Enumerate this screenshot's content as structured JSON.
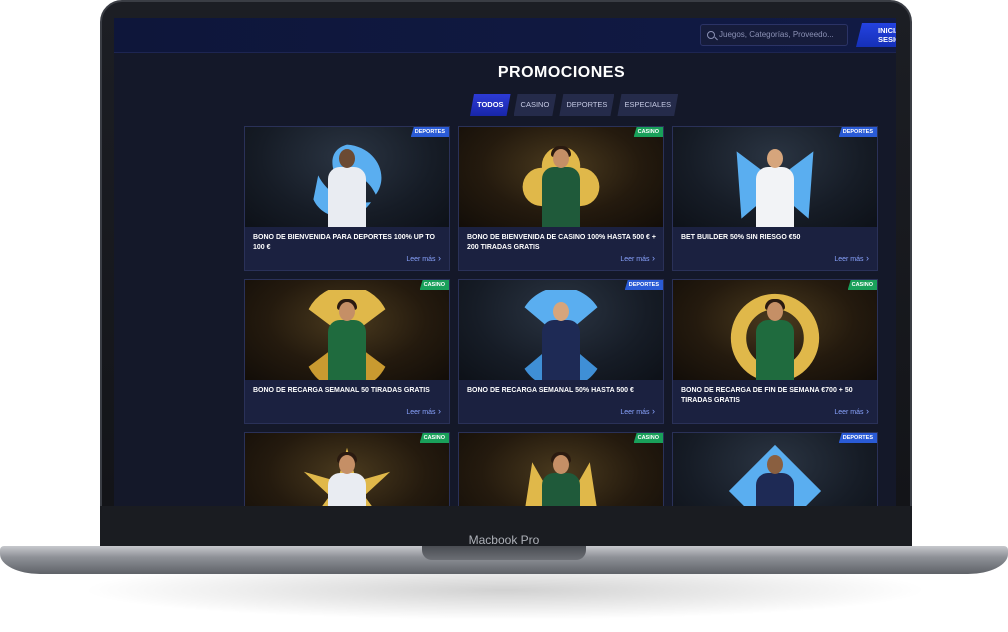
{
  "device": {
    "label": "Macbook Pro"
  },
  "header": {
    "search_placeholder": "Juegos, Categorías, Proveedo...",
    "login_label": "INICIAR SESIÓN"
  },
  "page": {
    "title": "PROMOCIONES"
  },
  "tabs": [
    {
      "label": "TODOS",
      "active": true
    },
    {
      "label": "CASINO",
      "active": false
    },
    {
      "label": "DEPORTES",
      "active": false
    },
    {
      "label": "ESPECIALES",
      "active": false
    }
  ],
  "promotions": [
    {
      "category": "DEPORTES",
      "title": "BONO DE BIENVENIDA PARA DEPORTES 100% UP TO 100 €",
      "link": "Leer más"
    },
    {
      "category": "CASINO",
      "title": "BONO DE BIENVENIDA DE CASINO 100% HASTA 500 € + 200 TIRADAS GRATIS",
      "link": "Leer más"
    },
    {
      "category": "DEPORTES",
      "title": "BET BUILDER 50% SIN RIESGO €50",
      "link": "Leer más"
    },
    {
      "category": "CASINO",
      "title": "BONO DE RECARGA SEMANAL 50 TIRADAS GRATIS",
      "link": "Leer más"
    },
    {
      "category": "DEPORTES",
      "title": "BONO DE RECARGA SEMANAL 50% HASTA 500 €",
      "link": "Leer más"
    },
    {
      "category": "CASINO",
      "title": "BONO DE RECARGA DE FIN DE SEMANA €700 + 50 TIRADAS GRATIS",
      "link": "Leer más"
    },
    {
      "category": "CASINO",
      "title": "",
      "link": ""
    },
    {
      "category": "CASINO",
      "title": "",
      "link": ""
    },
    {
      "category": "DEPORTES",
      "title": "",
      "link": ""
    }
  ],
  "colors": {
    "background": "#141829",
    "accent": "#2442e0",
    "casino_badge": "#19a05a",
    "sports_badge": "#2a5bd6",
    "link": "#8aa4ff"
  }
}
